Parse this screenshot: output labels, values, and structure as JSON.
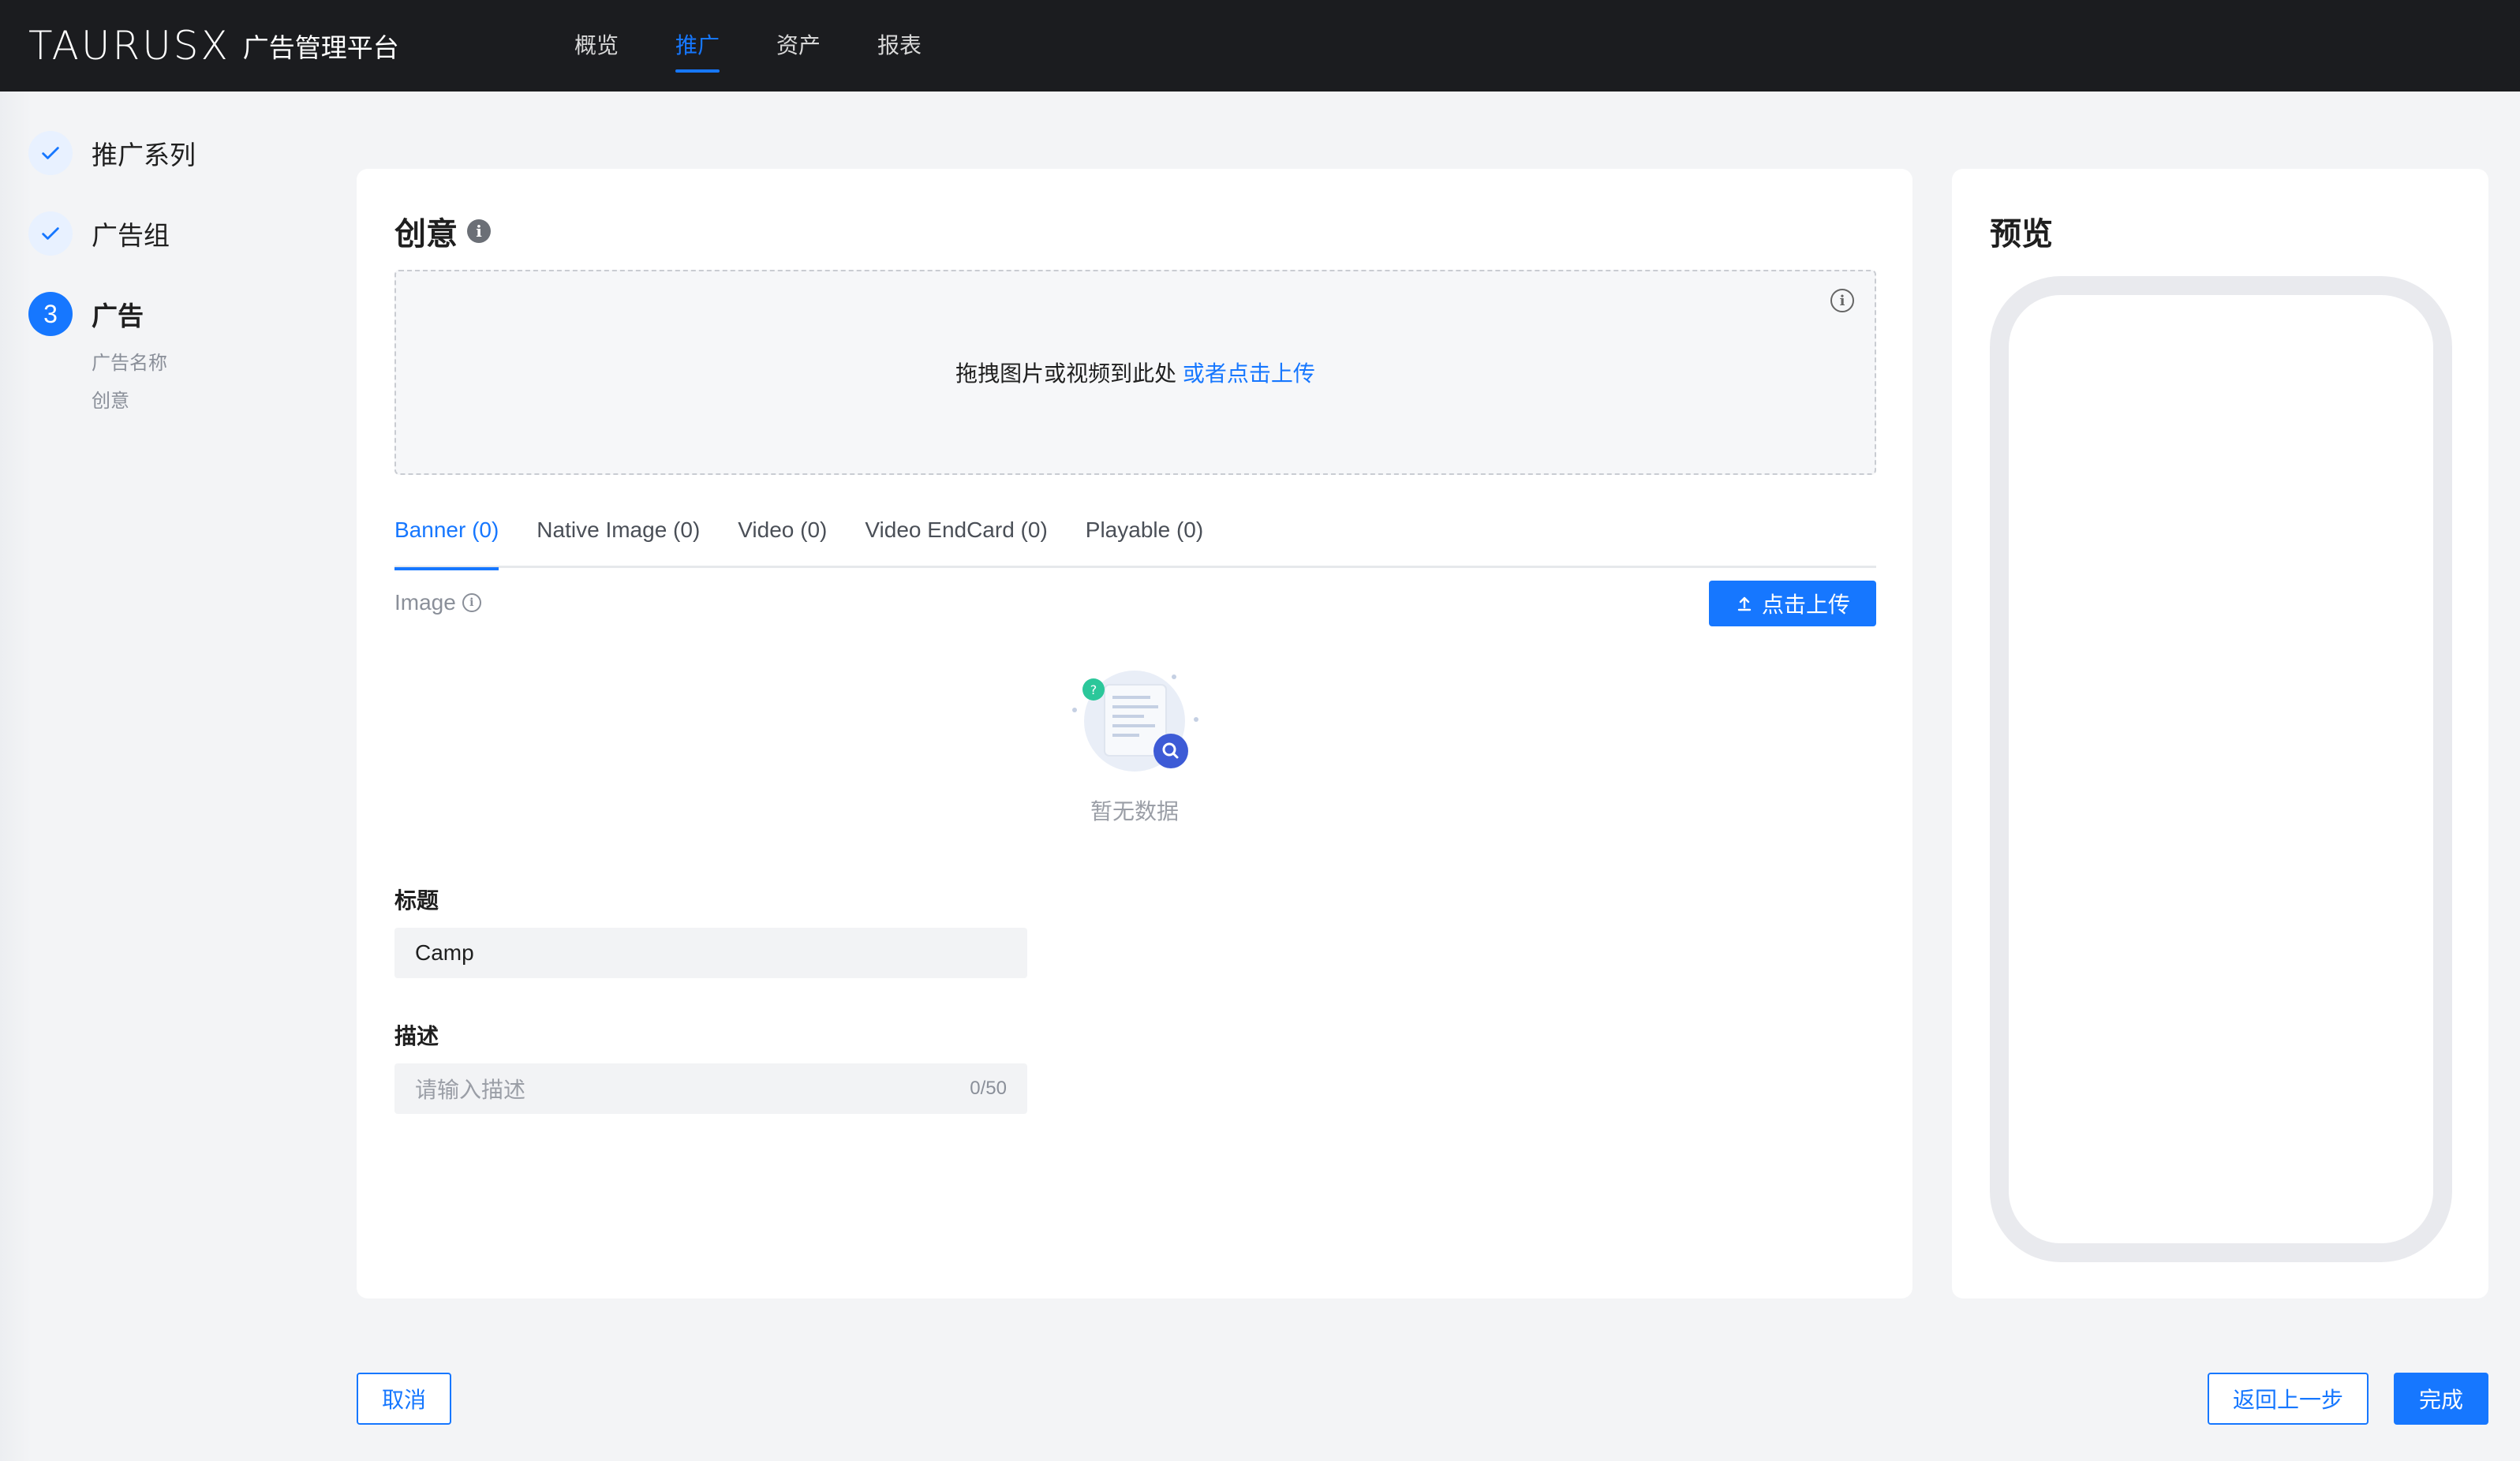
{
  "header": {
    "logo_text": "TAURUSX",
    "app_name": "广告管理平台",
    "nav": [
      {
        "label": "概览",
        "active": false
      },
      {
        "label": "推广",
        "active": true
      },
      {
        "label": "资产",
        "active": false
      },
      {
        "label": "报表",
        "active": false
      }
    ]
  },
  "steps": {
    "items": [
      {
        "label": "推广系列",
        "status": "done"
      },
      {
        "label": "广告组",
        "status": "done"
      },
      {
        "label": "广告",
        "status": "current",
        "number": "3"
      }
    ],
    "substeps": [
      "广告名称",
      "创意"
    ]
  },
  "creative": {
    "title": "创意",
    "dropzone_text": "拖拽图片或视频到此处",
    "dropzone_link": "或者点击上传",
    "tabs": [
      {
        "label": "Banner (0)",
        "active": true
      },
      {
        "label": "Native Image (0)",
        "active": false
      },
      {
        "label": "Video (0)",
        "active": false
      },
      {
        "label": "Video EndCard (0)",
        "active": false
      },
      {
        "label": "Playable (0)",
        "active": false
      }
    ],
    "image_label": "Image",
    "upload_button": "点击上传",
    "empty_text": "暂无数据",
    "title_field": {
      "label": "标题",
      "value": "Camp"
    },
    "desc_field": {
      "label": "描述",
      "placeholder": "请输入描述",
      "count": "0/50"
    }
  },
  "preview": {
    "title": "预览"
  },
  "footer": {
    "cancel": "取消",
    "back": "返回上一步",
    "finish": "完成"
  },
  "colors": {
    "accent": "#1677ff",
    "nav_bg": "#1b1c1f"
  }
}
